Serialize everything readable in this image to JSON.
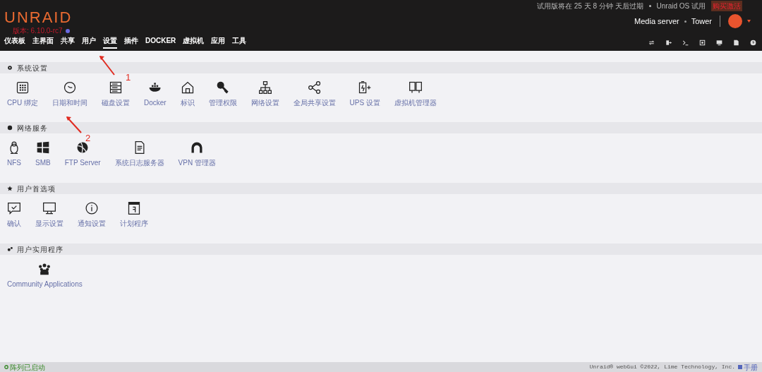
{
  "header": {
    "logo": "UNRAID",
    "version": "版本: 6.10.0-rc7",
    "trial_notice": "试用版将在 25 天 8 分钟 天后过期",
    "os_label": "Unraid OS 试用",
    "buy_link": "购买激活",
    "server_name": "Media server",
    "server_host": "Tower"
  },
  "nav": [
    {
      "label": "仪表板",
      "selected": false
    },
    {
      "label": "主界面",
      "selected": false
    },
    {
      "label": "共享",
      "selected": false
    },
    {
      "label": "用户",
      "selected": false
    },
    {
      "label": "设置",
      "selected": true
    },
    {
      "label": "插件",
      "selected": false
    },
    {
      "label": "DOCKER",
      "selected": false
    },
    {
      "label": "虚拟机",
      "selected": false
    },
    {
      "label": "应用",
      "selected": false
    },
    {
      "label": "工具",
      "selected": false
    }
  ],
  "sections": [
    {
      "title": "系统设置",
      "items": [
        "CPU 绑定",
        "日期和时间",
        "磁盘设置",
        "Docker",
        "标识",
        "管理权限",
        "网络设置",
        "全局共享设置",
        "UPS 设置",
        "虚拟机管理器"
      ]
    },
    {
      "title": "网络服务",
      "items": [
        "NFS",
        "SMB",
        "FTP Server",
        "系统日志服务器",
        "VPN 管理器"
      ]
    },
    {
      "title": "用户首选项",
      "items": [
        "确认",
        "显示设置",
        "通知设置",
        "计划程序"
      ]
    },
    {
      "title": "用户实用程序",
      "items": [
        "Community Applications"
      ]
    }
  ],
  "annotations": [
    {
      "label": "1"
    },
    {
      "label": "2"
    }
  ],
  "footer": {
    "status": "阵列已启动",
    "copyright": "Unraid® webGui ©2022, Lime Technology, Inc.",
    "manual": "手册"
  }
}
